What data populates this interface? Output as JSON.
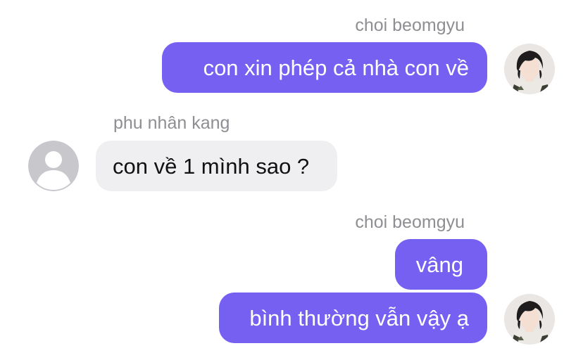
{
  "messages": [
    {
      "sender": "choi beomgyu",
      "text": "con xin phép cả nhà con về"
    },
    {
      "sender": "phu nhân kang",
      "text": "con về 1 mình sao ?"
    },
    {
      "sender": "choi beomgyu",
      "text": "vâng"
    },
    {
      "sender": "choi beomgyu",
      "text": "bình thường vẫn vậy ạ"
    }
  ],
  "colors": {
    "outgoing_bubble": "#7560f2",
    "incoming_bubble": "#efeff1",
    "sender_name": "#8e8e93"
  },
  "icons": {
    "sender_avatar": "user-photo-avatar",
    "default_avatar": "default-person-avatar-icon"
  }
}
